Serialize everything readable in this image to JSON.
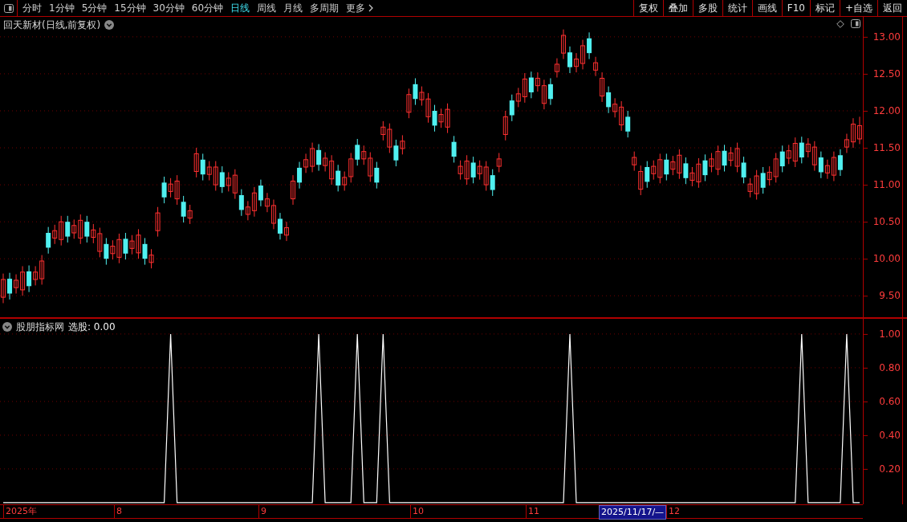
{
  "toolbar": {
    "periods": [
      {
        "label": "分时",
        "selected": false
      },
      {
        "label": "1分钟",
        "selected": false
      },
      {
        "label": "5分钟",
        "selected": false
      },
      {
        "label": "15分钟",
        "selected": false
      },
      {
        "label": "30分钟",
        "selected": false
      },
      {
        "label": "60分钟",
        "selected": false
      },
      {
        "label": "日线",
        "selected": true
      },
      {
        "label": "周线",
        "selected": false
      },
      {
        "label": "月线",
        "selected": false
      },
      {
        "label": "多周期",
        "selected": false
      },
      {
        "label": "更多",
        "selected": false
      }
    ],
    "actions": [
      "复权",
      "叠加",
      "多股",
      "统计",
      "画线",
      "F10",
      "标记",
      "+自选",
      "返回"
    ]
  },
  "price_panel": {
    "title": "回天新材(日线,前复权)",
    "chart_data": {
      "type": "candlestick",
      "grid": true,
      "categories": [
        null,
        null,
        null,
        null,
        null,
        null,
        null,
        null,
        null,
        null,
        null,
        null,
        null,
        null,
        null,
        null,
        null,
        null,
        null,
        null,
        null,
        null,
        null,
        null,
        null,
        null,
        null,
        null,
        null,
        null,
        null,
        null,
        null,
        null,
        null,
        null,
        null,
        null,
        null,
        null,
        null,
        null,
        null,
        null,
        null,
        null,
        null,
        null,
        null,
        null,
        null,
        null,
        null,
        null,
        null,
        null,
        null,
        null,
        null,
        null,
        null,
        null,
        null,
        null,
        null,
        null,
        null,
        null,
        null,
        null,
        null,
        null,
        null,
        null,
        null,
        null,
        null,
        null,
        null,
        null,
        null,
        null,
        null,
        null,
        null,
        null,
        null,
        null,
        null,
        null,
        null,
        null,
        null,
        null,
        null,
        null,
        null,
        null,
        null,
        null,
        null,
        null,
        null,
        null,
        null,
        null,
        null,
        null,
        null,
        null,
        null,
        null,
        null,
        null,
        null,
        null,
        null,
        null,
        null,
        null,
        null,
        null,
        null,
        null,
        null,
        null,
        null,
        null,
        null,
        null,
        null,
        null,
        null,
        null
      ],
      "ylim": [
        9.21,
        13.27
      ],
      "yticks": [
        {
          "value": 13,
          "label": "13.00"
        },
        {
          "value": 12.5,
          "label": "12.50"
        },
        {
          "value": 12,
          "label": "12.00"
        },
        {
          "value": 11.5,
          "label": "11.50"
        },
        {
          "value": 11,
          "label": "11.00"
        },
        {
          "value": 10.5,
          "label": "10.50"
        },
        {
          "value": 10,
          "label": "10.00"
        },
        {
          "value": 9.5,
          "label": "9.50"
        }
      ],
      "ohlc": [
        [
          9.48,
          9.8,
          9.4,
          9.72
        ],
        [
          9.73,
          9.81,
          9.45,
          9.53
        ],
        [
          9.61,
          9.79,
          9.53,
          9.71
        ],
        [
          9.58,
          9.9,
          9.5,
          9.82
        ],
        [
          9.83,
          9.91,
          9.55,
          9.63
        ],
        [
          9.72,
          9.9,
          9.64,
          9.82
        ],
        [
          9.73,
          10.05,
          9.65,
          9.97
        ],
        [
          10.35,
          10.43,
          10.07,
          10.15
        ],
        [
          10.28,
          10.46,
          10.2,
          10.38
        ],
        [
          10.26,
          10.58,
          10.18,
          10.5
        ],
        [
          10.5,
          10.58,
          10.22,
          10.3
        ],
        [
          10.35,
          10.53,
          10.27,
          10.45
        ],
        [
          10.28,
          10.6,
          10.2,
          10.52
        ],
        [
          10.5,
          10.58,
          10.22,
          10.3
        ],
        [
          10.29,
          10.47,
          10.21,
          10.39
        ],
        [
          10.1,
          10.42,
          10.02,
          10.34
        ],
        [
          10.2,
          10.28,
          9.92,
          10.0
        ],
        [
          10.07,
          10.25,
          9.99,
          10.17
        ],
        [
          10.02,
          10.34,
          9.94,
          10.26
        ],
        [
          10.27,
          10.35,
          9.99,
          10.07
        ],
        [
          10.14,
          10.32,
          10.06,
          10.24
        ],
        [
          10.08,
          10.4,
          10.0,
          10.32
        ],
        [
          10.2,
          10.28,
          9.92,
          10.0
        ],
        [
          9.95,
          10.13,
          9.87,
          10.05
        ],
        [
          10.38,
          10.7,
          10.3,
          10.62
        ],
        [
          11.03,
          11.11,
          10.75,
          10.83
        ],
        [
          10.91,
          11.09,
          10.83,
          11.01
        ],
        [
          10.81,
          11.13,
          10.73,
          11.05
        ],
        [
          10.77,
          10.85,
          10.49,
          10.57
        ],
        [
          10.55,
          10.73,
          10.47,
          10.65
        ],
        [
          11.18,
          11.5,
          11.1,
          11.42
        ],
        [
          11.34,
          11.42,
          11.06,
          11.14
        ],
        [
          11.14,
          11.32,
          11.06,
          11.24
        ],
        [
          11.0,
          11.32,
          10.92,
          11.24
        ],
        [
          11.17,
          11.25,
          10.89,
          10.97
        ],
        [
          10.99,
          11.17,
          10.91,
          11.09
        ],
        [
          10.89,
          11.21,
          10.81,
          11.13
        ],
        [
          10.86,
          10.94,
          10.58,
          10.66
        ],
        [
          10.6,
          10.78,
          10.52,
          10.7
        ],
        [
          10.65,
          10.97,
          10.57,
          10.89
        ],
        [
          10.99,
          11.07,
          10.71,
          10.79
        ],
        [
          10.71,
          10.89,
          10.63,
          10.81
        ],
        [
          10.48,
          10.8,
          10.4,
          10.72
        ],
        [
          10.54,
          10.62,
          10.26,
          10.34
        ],
        [
          10.32,
          10.5,
          10.24,
          10.42
        ],
        [
          10.81,
          11.13,
          10.73,
          11.05
        ],
        [
          11.23,
          11.31,
          10.95,
          11.03
        ],
        [
          11.24,
          11.42,
          11.16,
          11.34
        ],
        [
          11.25,
          11.57,
          11.17,
          11.49
        ],
        [
          11.47,
          11.55,
          11.19,
          11.27
        ],
        [
          11.26,
          11.44,
          11.18,
          11.36
        ],
        [
          11.08,
          11.4,
          11.0,
          11.32
        ],
        [
          11.19,
          11.27,
          10.91,
          10.99
        ],
        [
          11.0,
          11.18,
          10.92,
          11.1
        ],
        [
          11.11,
          11.43,
          11.03,
          11.35
        ],
        [
          11.54,
          11.62,
          11.26,
          11.34
        ],
        [
          11.35,
          11.53,
          11.27,
          11.45
        ],
        [
          11.12,
          11.44,
          11.04,
          11.36
        ],
        [
          11.23,
          11.31,
          10.95,
          11.03
        ],
        [
          11.68,
          11.86,
          11.6,
          11.78
        ],
        [
          11.51,
          11.83,
          11.43,
          11.75
        ],
        [
          11.53,
          11.61,
          11.25,
          11.33
        ],
        [
          11.49,
          11.67,
          11.41,
          11.59
        ],
        [
          11.98,
          12.3,
          11.9,
          12.22
        ],
        [
          12.36,
          12.44,
          12.08,
          12.16
        ],
        [
          12.15,
          12.33,
          12.07,
          12.25
        ],
        [
          11.92,
          12.24,
          11.84,
          12.16
        ],
        [
          12.0,
          12.08,
          11.72,
          11.8
        ],
        [
          11.85,
          12.03,
          11.77,
          11.95
        ],
        [
          11.78,
          12.1,
          11.7,
          12.02
        ],
        [
          11.58,
          11.66,
          11.3,
          11.38
        ],
        [
          11.15,
          11.33,
          11.07,
          11.25
        ],
        [
          11.08,
          11.4,
          11.0,
          11.32
        ],
        [
          11.3,
          11.38,
          11.02,
          11.1
        ],
        [
          11.15,
          11.33,
          11.07,
          11.25
        ],
        [
          11.0,
          11.32,
          10.92,
          11.24
        ],
        [
          11.13,
          11.21,
          10.85,
          10.93
        ],
        [
          11.25,
          11.43,
          11.17,
          11.35
        ],
        [
          11.68,
          12.0,
          11.6,
          11.92
        ],
        [
          12.14,
          12.22,
          11.86,
          11.94
        ],
        [
          12.13,
          12.31,
          12.05,
          12.23
        ],
        [
          12.19,
          12.51,
          12.11,
          12.43
        ],
        [
          12.45,
          12.53,
          12.17,
          12.25
        ],
        [
          12.34,
          12.52,
          12.26,
          12.44
        ],
        [
          12.1,
          12.42,
          12.02,
          12.34
        ],
        [
          12.36,
          12.44,
          12.08,
          12.16
        ],
        [
          12.53,
          12.71,
          12.45,
          12.63
        ],
        [
          12.78,
          13.1,
          12.7,
          13.02
        ],
        [
          12.79,
          12.87,
          12.51,
          12.59
        ],
        [
          12.6,
          12.78,
          12.52,
          12.7
        ],
        [
          12.64,
          12.96,
          12.56,
          12.88
        ],
        [
          12.98,
          13.06,
          12.7,
          12.78
        ],
        [
          12.55,
          12.73,
          12.47,
          12.65
        ],
        [
          12.2,
          12.52,
          12.12,
          12.44
        ],
        [
          12.25,
          12.33,
          11.97,
          12.05
        ],
        [
          11.99,
          12.17,
          11.91,
          12.09
        ],
        [
          11.81,
          12.13,
          11.73,
          12.05
        ],
        [
          11.92,
          12.0,
          11.64,
          11.72
        ],
        [
          11.27,
          11.45,
          11.19,
          11.37
        ],
        [
          10.94,
          11.26,
          10.86,
          11.18
        ],
        [
          11.24,
          11.32,
          10.96,
          11.04
        ],
        [
          11.15,
          11.33,
          11.07,
          11.25
        ],
        [
          11.1,
          11.42,
          11.02,
          11.34
        ],
        [
          11.34,
          11.42,
          11.06,
          11.14
        ],
        [
          11.21,
          11.39,
          11.13,
          11.31
        ],
        [
          11.16,
          11.48,
          11.08,
          11.4
        ],
        [
          11.29,
          11.37,
          11.01,
          11.09
        ],
        [
          11.06,
          11.24,
          10.98,
          11.16
        ],
        [
          11.04,
          11.36,
          10.96,
          11.28
        ],
        [
          11.33,
          11.41,
          11.05,
          11.13
        ],
        [
          11.25,
          11.43,
          11.17,
          11.35
        ],
        [
          11.21,
          11.53,
          11.13,
          11.45
        ],
        [
          11.46,
          11.54,
          11.18,
          11.26
        ],
        [
          11.33,
          11.51,
          11.25,
          11.43
        ],
        [
          11.25,
          11.57,
          11.17,
          11.49
        ],
        [
          11.3,
          11.38,
          11.02,
          11.1
        ],
        [
          10.91,
          11.09,
          10.83,
          11.01
        ],
        [
          10.88,
          11.2,
          10.8,
          11.12
        ],
        [
          11.16,
          11.24,
          10.88,
          10.96
        ],
        [
          11.07,
          11.25,
          10.99,
          11.17
        ],
        [
          11.11,
          11.43,
          11.03,
          11.35
        ],
        [
          11.45,
          11.53,
          11.17,
          11.25
        ],
        [
          11.36,
          11.54,
          11.28,
          11.46
        ],
        [
          11.32,
          11.64,
          11.24,
          11.56
        ],
        [
          11.57,
          11.65,
          11.29,
          11.37
        ],
        [
          11.45,
          11.63,
          11.37,
          11.55
        ],
        [
          11.27,
          11.59,
          11.19,
          11.51
        ],
        [
          11.37,
          11.45,
          11.09,
          11.17
        ],
        [
          11.16,
          11.34,
          11.08,
          11.26
        ],
        [
          11.13,
          11.45,
          11.05,
          11.37
        ],
        [
          11.4,
          11.48,
          11.12,
          11.2
        ],
        [
          11.51,
          11.69,
          11.43,
          11.61
        ],
        [
          11.58,
          11.9,
          11.5,
          11.82
        ],
        [
          11.62,
          11.92,
          11.55,
          11.8
        ]
      ]
    }
  },
  "indicator_panel": {
    "title": "股朋指标网",
    "reading": ": 0.00",
    "chart_data": {
      "type": "line",
      "grid": true,
      "categories": [
        null,
        null,
        null,
        null,
        null,
        null,
        null,
        null,
        null,
        null,
        null,
        null,
        null,
        null,
        null,
        null,
        null,
        null,
        null,
        null,
        null,
        null,
        null,
        null,
        null,
        null,
        null,
        null,
        null,
        null,
        null,
        null,
        null,
        null,
        null,
        null,
        null,
        null,
        null,
        null,
        null,
        null,
        null,
        null,
        null,
        null,
        null,
        null,
        null,
        null,
        null,
        null,
        null,
        null,
        null,
        null,
        null,
        null,
        null,
        null,
        null,
        null,
        null,
        null,
        null,
        null,
        null,
        null,
        null,
        null,
        null,
        null,
        null,
        null,
        null,
        null,
        null,
        null,
        null,
        null,
        null,
        null,
        null,
        null,
        null,
        null,
        null,
        null,
        null,
        null,
        null,
        null,
        null,
        null,
        null,
        null,
        null,
        null,
        null,
        null,
        null,
        null,
        null,
        null,
        null,
        null,
        null,
        null,
        null,
        null,
        null,
        null,
        null,
        null,
        null,
        null,
        null,
        null,
        null,
        null,
        null,
        null,
        null,
        null,
        null,
        null,
        null,
        null,
        null,
        null,
        null,
        null,
        null,
        null
      ],
      "ylim": [
        -0.01,
        1.09
      ],
      "yticks": [
        {
          "value": 0.2,
          "label": "0.20"
        },
        {
          "value": 0.4,
          "label": "0.40"
        },
        {
          "value": 0.6,
          "label": "0.60"
        },
        {
          "value": 0.8,
          "label": "0.80"
        },
        {
          "value": 1,
          "label": "1.00"
        }
      ],
      "series": [
        {
          "name": "选股",
          "color": "#ffffff",
          "values": [
            0,
            0,
            0,
            0,
            0,
            0,
            0,
            0,
            0,
            0,
            0,
            0,
            0,
            0,
            0,
            0,
            0,
            0,
            0,
            0,
            0,
            0,
            0,
            0,
            0,
            0,
            1,
            0,
            0,
            0,
            0,
            0,
            0,
            0,
            0,
            0,
            0,
            0,
            0,
            0,
            0,
            0,
            0,
            0,
            0,
            0,
            0,
            0,
            0,
            1,
            0,
            0,
            0,
            0,
            0,
            1,
            0,
            0,
            0,
            1,
            0,
            0,
            0,
            0,
            0,
            0,
            0,
            0,
            0,
            0,
            0,
            0,
            0,
            0,
            0,
            0,
            0,
            0,
            0,
            0,
            0,
            0,
            0,
            0,
            0,
            0,
            0,
            0,
            1,
            0,
            0,
            0,
            0,
            0,
            0,
            0,
            0,
            0,
            0,
            0,
            0,
            0,
            0,
            0,
            0,
            0,
            0,
            0,
            0,
            0,
            0,
            0,
            0,
            0,
            0,
            0,
            0,
            0,
            0,
            0,
            0,
            0,
            0,
            0,
            1,
            0,
            0,
            0,
            0,
            0,
            0,
            1,
            0,
            0
          ]
        }
      ]
    }
  },
  "date_axis": {
    "labels": [
      "2025年",
      "8",
      "9",
      "10",
      "11",
      "12"
    ],
    "cursor_date": "2025/11/17/—"
  }
}
